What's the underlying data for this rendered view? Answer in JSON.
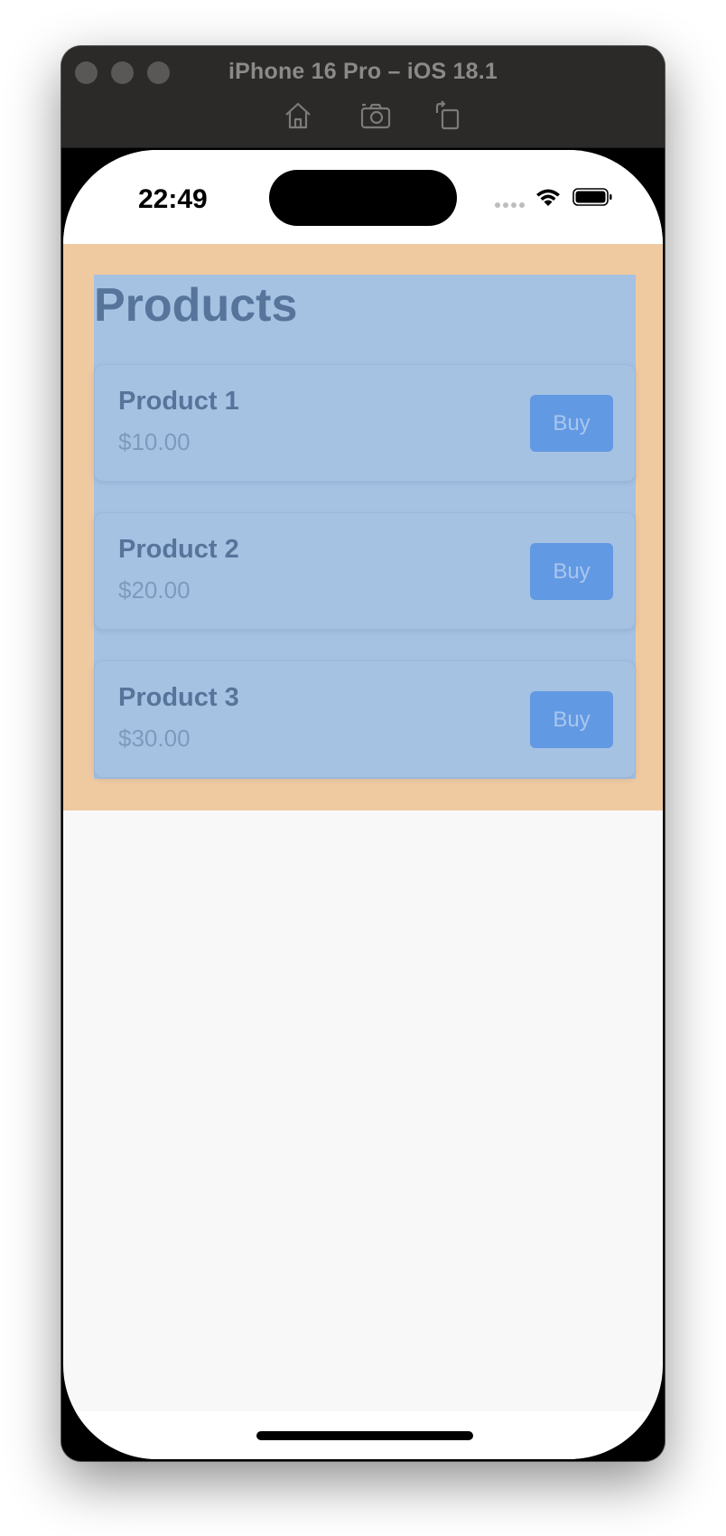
{
  "simulator": {
    "window_title": "iPhone 16 Pro – iOS 18.1",
    "toolbar": {
      "home_icon": "home-icon",
      "screenshot_icon": "camera-icon",
      "rotate_icon": "rotate-icon"
    }
  },
  "status_bar": {
    "time": "22:49",
    "signal_icon": "cellular-dots-icon",
    "wifi_icon": "wifi-icon",
    "battery_icon": "battery-icon"
  },
  "app": {
    "title": "Products",
    "products": [
      {
        "name": "Product 1",
        "price": "$10.00",
        "button_label": "Buy"
      },
      {
        "name": "Product 2",
        "price": "$20.00",
        "button_label": "Buy"
      },
      {
        "name": "Product 3",
        "price": "$30.00",
        "button_label": "Buy"
      }
    ]
  },
  "colors": {
    "container_background": "#efc9a0",
    "content_background": "#a6c2e3",
    "title_text": "#57749b",
    "buy_button": "#6299e3",
    "screen_background": "#f8f8f8"
  }
}
